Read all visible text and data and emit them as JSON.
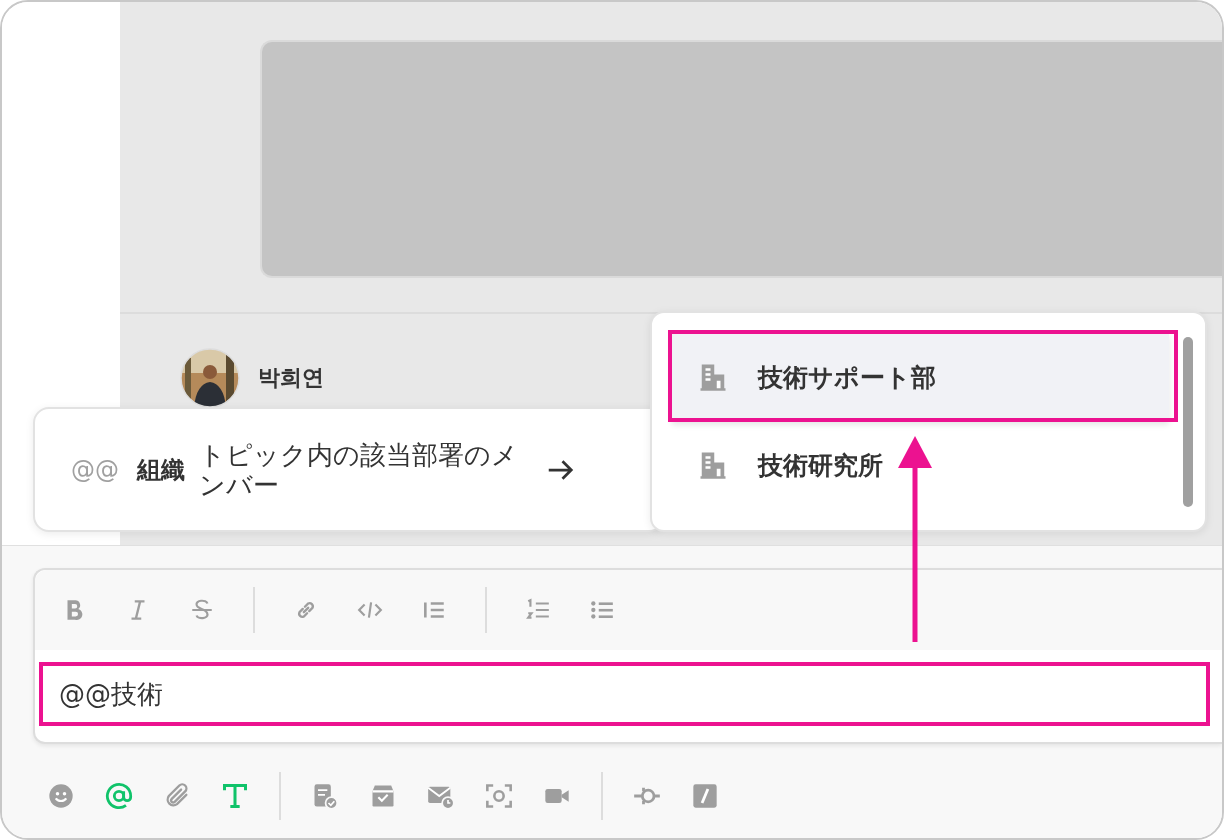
{
  "message": {
    "author": "박희연"
  },
  "mention_hint": {
    "trigger": "@@",
    "label": "組織",
    "description": "トピック内の該当部署のメンバー"
  },
  "suggestions": [
    {
      "name": "技術サポート部",
      "selected": true
    },
    {
      "name": "技術研究所",
      "selected": false
    }
  ],
  "format_tools": [
    {
      "kind": "bold"
    },
    {
      "kind": "italic"
    },
    {
      "kind": "strike"
    },
    {
      "kind": "sep"
    },
    {
      "kind": "link"
    },
    {
      "kind": "code"
    },
    {
      "kind": "quote"
    },
    {
      "kind": "sep"
    },
    {
      "kind": "numbered"
    },
    {
      "kind": "bulleted"
    }
  ],
  "composer": {
    "value": "@@技術"
  },
  "tools": [
    {
      "kind": "emoji",
      "active": false
    },
    {
      "kind": "mention",
      "active": true
    },
    {
      "kind": "attach",
      "active": false
    },
    {
      "kind": "text",
      "active": true
    },
    {
      "kind": "sep"
    },
    {
      "kind": "task",
      "active": false
    },
    {
      "kind": "archive",
      "active": false
    },
    {
      "kind": "schedule",
      "active": false
    },
    {
      "kind": "capture",
      "active": false
    },
    {
      "kind": "video",
      "active": false
    },
    {
      "kind": "sep"
    },
    {
      "kind": "commit",
      "active": false
    },
    {
      "kind": "slash",
      "active": false
    }
  ]
}
